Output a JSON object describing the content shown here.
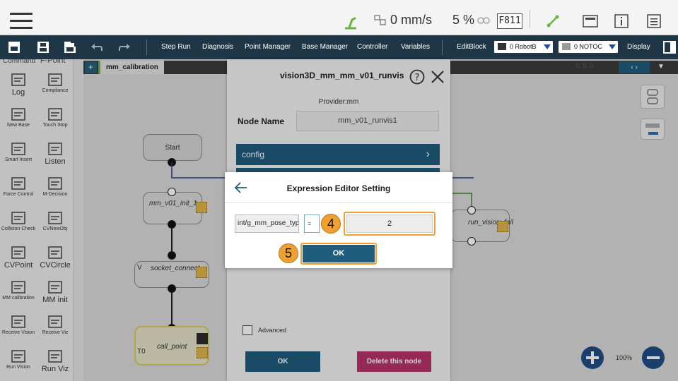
{
  "status": {
    "speed": "0 mm/s",
    "percent": "5 %",
    "fcode": "F811"
  },
  "toolbar": {
    "items": [
      "Step Run",
      "Diagnosis",
      "Point Manager",
      "Base Manager",
      "Controller",
      "Variables"
    ],
    "editblock": "EditBlock",
    "robot_select": "0 RobotB",
    "tool_select": "0 NOTOC",
    "display": "Display"
  },
  "palette": {
    "header": [
      "Command",
      "F-Point"
    ],
    "items": [
      {
        "label": "Log",
        "big": true
      },
      {
        "label": "Compliance",
        "big": false
      },
      {
        "label": "New Base",
        "big": false
      },
      {
        "label": "Touch Stop",
        "big": false
      },
      {
        "label": "Smart Insert",
        "big": false
      },
      {
        "label": "Listen",
        "big": true
      },
      {
        "label": "Force Control",
        "big": false
      },
      {
        "label": "M-Decision",
        "big": false
      },
      {
        "label": "Collision Check",
        "big": false
      },
      {
        "label": "CVNewObj",
        "big": false
      },
      {
        "label": "CVPoint",
        "big": true
      },
      {
        "label": "CVCircle",
        "big": true
      },
      {
        "label": "MM calibration",
        "big": false
      },
      {
        "label": "MM init",
        "big": true
      },
      {
        "label": "Receive Vision",
        "big": false
      },
      {
        "label": "Receive Viz",
        "big": false
      },
      {
        "label": "Run Vision",
        "big": false
      },
      {
        "label": "Run Viz",
        "big": true
      }
    ]
  },
  "canvas": {
    "tab": "mm_calibration",
    "nodes": {
      "start": "Start",
      "init": "mm_v01_init_1",
      "socket": "socket_connect",
      "call": "call_point",
      "fail": "run_vision_fail"
    },
    "socket_tag": "V",
    "call_tag": "T0",
    "zoom": "100%"
  },
  "node_panel": {
    "title": "vision3D_mm_mm_v01_runvis",
    "provider": "Provider:mm",
    "node_name_label": "Node Name",
    "node_name_value": "mm_v01_runvis1",
    "section": "config",
    "advanced": "Advanced",
    "ok": "OK",
    "delete": "Delete this node"
  },
  "dialog": {
    "title": "Expression Editor Setting",
    "variable": "int/g_mm_pose_typ",
    "operator": "=",
    "value": "2",
    "ok": "OK",
    "badge_value": "4",
    "badge_ok": "5"
  },
  "colors": {
    "toolbar": "#1e3646",
    "primary": "#1f5c7e",
    "highlight": "#f0a030",
    "delete": "#b8336a"
  }
}
